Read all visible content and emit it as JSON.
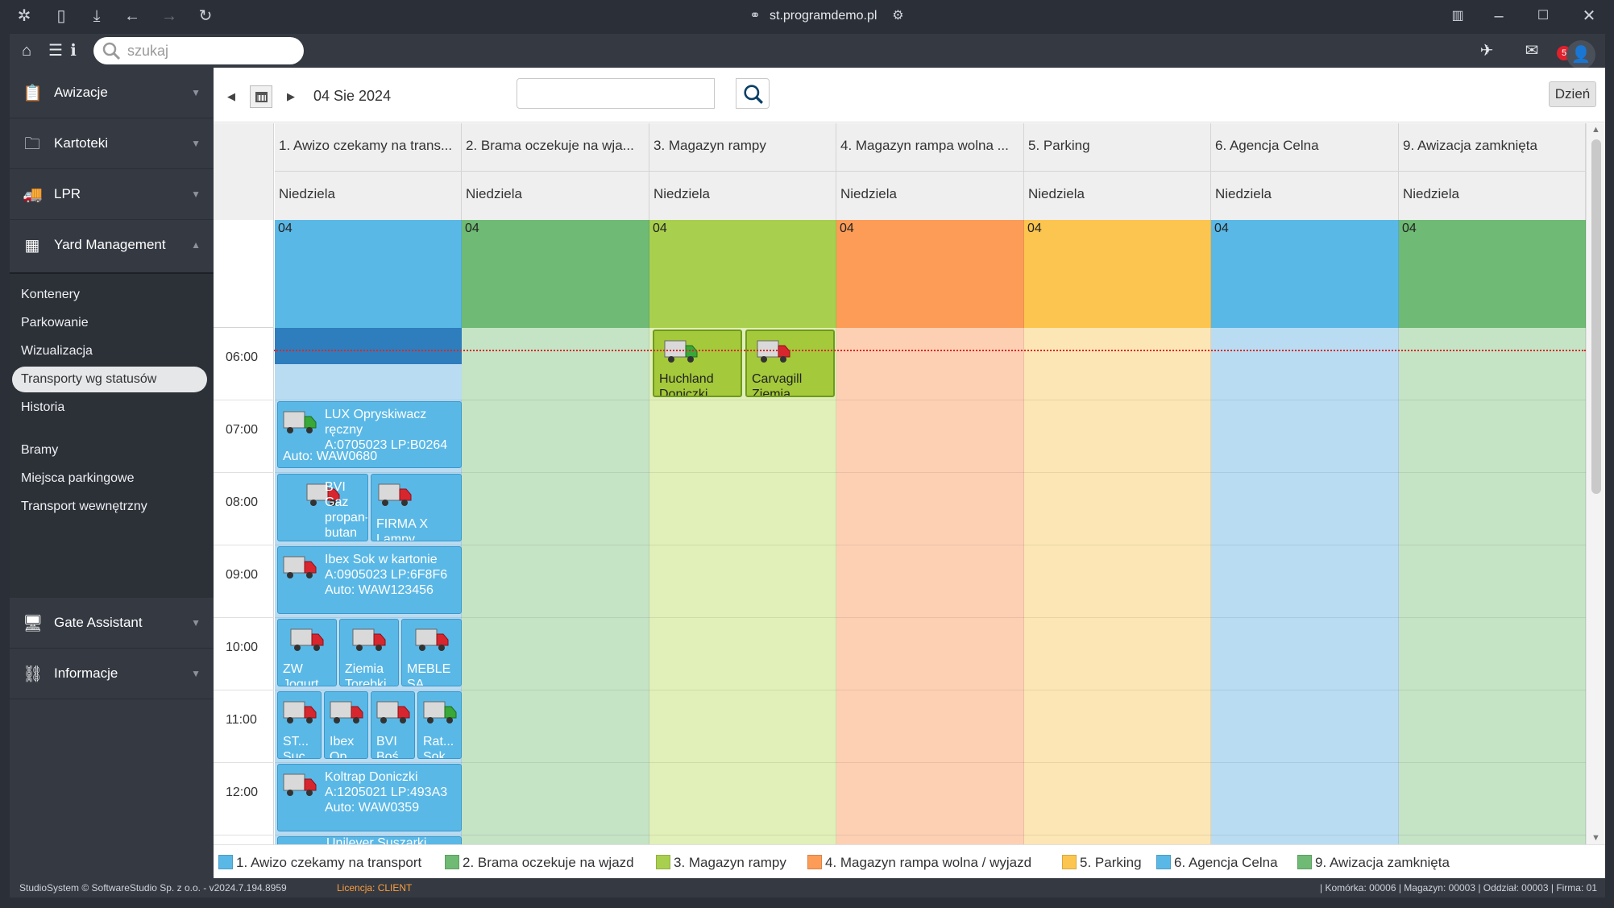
{
  "browser": {
    "url": "st.programdemo.pl"
  },
  "topbar": {
    "search_placeholder": "szukaj",
    "mail_count": "5"
  },
  "sidebar": {
    "sections": [
      {
        "label": "Awizacje",
        "icon": "clipboard-icon"
      },
      {
        "label": "Kartoteki",
        "icon": "folder-icon"
      },
      {
        "label": "LPR",
        "icon": "truck-icon"
      },
      {
        "label": "Yard Management",
        "icon": "checkerboard-icon"
      },
      {
        "label": "Gate Assistant",
        "icon": "gate-assistant-icon"
      },
      {
        "label": "Informacje",
        "icon": "sitemap-icon"
      }
    ],
    "yard_items": [
      "Kontenery",
      "Parkowanie",
      "Wizualizacja",
      "Transporty wg statusów",
      "Historia",
      "Bramy",
      "Miejsca parkingowe",
      "Transport wewnętrzny"
    ],
    "active_item": "Transporty wg statusów"
  },
  "toolbar": {
    "date": "04 Sie 2024",
    "view_button": "Dzień"
  },
  "calendar": {
    "columns": [
      {
        "title": "1. Awizo czekamy na trans...",
        "day": "Niedziela",
        "date": "04",
        "color": "#5ab8e6",
        "body_color": "#b9dcf2"
      },
      {
        "title": "2. Brama oczekuje na wja...",
        "day": "Niedziela",
        "date": "04",
        "color": "#6fba74",
        "body_color": "#c5e3c5"
      },
      {
        "title": "3. Magazyn rampy",
        "day": "Niedziela",
        "date": "04",
        "color": "#a9cf4e",
        "body_color": "#e1efb8"
      },
      {
        "title": "4. Magazyn rampa wolna ...",
        "day": "Niedziela",
        "date": "04",
        "color": "#fc9c57",
        "body_color": "#fdd0b4"
      },
      {
        "title": "5. Parking",
        "day": "Niedziela",
        "date": "04",
        "color": "#fcc54f",
        "body_color": "#fce6b5"
      },
      {
        "title": "6. Agencja Celna",
        "day": "Niedziela",
        "date": "04",
        "color": "#5ab8e6",
        "body_color": "#b9dcf2"
      },
      {
        "title": "9. Awizacja zamknięta",
        "day": "Niedziela",
        "date": "04",
        "color": "#6fba74",
        "body_color": "#c5e3c5"
      }
    ],
    "hours": [
      "06:00",
      "07:00",
      "08:00",
      "09:00",
      "10:00",
      "11:00",
      "12:00"
    ],
    "events": {
      "lux": {
        "line1": "LUX Opryskiwacz ręczny",
        "line2": "A:0705023 LP:B0264",
        "auto": "Auto: WAW0680"
      },
      "bvi": {
        "text": "BVI\nGaz\npropan-butan"
      },
      "firma": {
        "text": "FIRMA X\nLampy"
      },
      "ibex": {
        "line1": "Ibex Sok w kartonie",
        "line2": "A:0905023 LP:6F8F6",
        "auto": "Auto: WAW123456"
      },
      "zw": {
        "text": "ZW\nJogurt"
      },
      "ziemia": {
        "text": "Ziemia\nTorebki"
      },
      "meble": {
        "text": "MEBLE\nSA"
      },
      "st": {
        "text": "ST...\nSuc"
      },
      "ibex2": {
        "text": "Ibex\nOp"
      },
      "bvi2": {
        "text": "BVI\nBoś"
      },
      "rat": {
        "text": "Rat...\nSok"
      },
      "koltrap": {
        "line1": "Koltrap Doniczki",
        "line2": "A:1205021 LP:493A3",
        "auto": "Auto: WAW0359"
      },
      "unilever": {
        "text": "Unilever Suszarki"
      },
      "huchland": {
        "text": "Huchland\nDoniczki"
      },
      "carvagill": {
        "text": "Carvagill\nZiemia"
      }
    }
  },
  "legend": [
    {
      "label": "1. Awizo czekamy na transport",
      "color": "#5ab8e6"
    },
    {
      "label": "2. Brama oczekuje na wjazd",
      "color": "#6fba74"
    },
    {
      "label": "3. Magazyn rampy",
      "color": "#a9cf4e"
    },
    {
      "label": "4. Magazyn rampa wolna / wyjazd",
      "color": "#fc9c57"
    },
    {
      "label": "5. Parking",
      "color": "#fcc54f"
    },
    {
      "label": "6. Agencja Celna",
      "color": "#5ab8e6"
    },
    {
      "label": "9. Awizacja zamknięta",
      "color": "#6fba74"
    }
  ],
  "footer": {
    "copyright": "StudioSystem © SoftwareStudio Sp. z o.o. - v2024.7.194.8959",
    "license": "Licencja: CLIENT",
    "info": "| Komórka: 00006 | Magazyn: 00003 | Oddział: 00003 | Firma: 01"
  }
}
